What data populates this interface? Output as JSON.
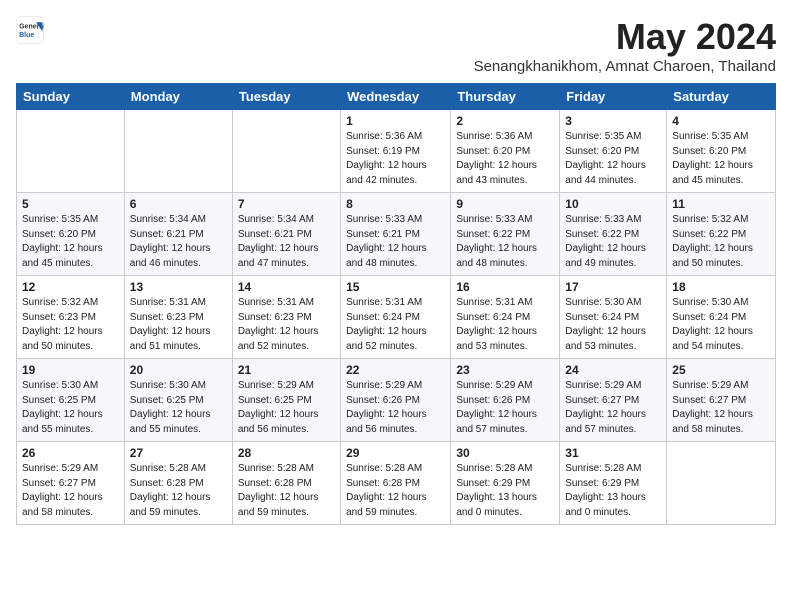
{
  "header": {
    "logo_general": "General",
    "logo_blue": "Blue",
    "month_title": "May 2024",
    "location": "Senangkhanikhom, Amnat Charoen, Thailand"
  },
  "weekdays": [
    "Sunday",
    "Monday",
    "Tuesday",
    "Wednesday",
    "Thursday",
    "Friday",
    "Saturday"
  ],
  "weeks": [
    [
      {
        "day": "",
        "info": ""
      },
      {
        "day": "",
        "info": ""
      },
      {
        "day": "",
        "info": ""
      },
      {
        "day": "1",
        "info": "Sunrise: 5:36 AM\nSunset: 6:19 PM\nDaylight: 12 hours\nand 42 minutes."
      },
      {
        "day": "2",
        "info": "Sunrise: 5:36 AM\nSunset: 6:20 PM\nDaylight: 12 hours\nand 43 minutes."
      },
      {
        "day": "3",
        "info": "Sunrise: 5:35 AM\nSunset: 6:20 PM\nDaylight: 12 hours\nand 44 minutes."
      },
      {
        "day": "4",
        "info": "Sunrise: 5:35 AM\nSunset: 6:20 PM\nDaylight: 12 hours\nand 45 minutes."
      }
    ],
    [
      {
        "day": "5",
        "info": "Sunrise: 5:35 AM\nSunset: 6:20 PM\nDaylight: 12 hours\nand 45 minutes."
      },
      {
        "day": "6",
        "info": "Sunrise: 5:34 AM\nSunset: 6:21 PM\nDaylight: 12 hours\nand 46 minutes."
      },
      {
        "day": "7",
        "info": "Sunrise: 5:34 AM\nSunset: 6:21 PM\nDaylight: 12 hours\nand 47 minutes."
      },
      {
        "day": "8",
        "info": "Sunrise: 5:33 AM\nSunset: 6:21 PM\nDaylight: 12 hours\nand 48 minutes."
      },
      {
        "day": "9",
        "info": "Sunrise: 5:33 AM\nSunset: 6:22 PM\nDaylight: 12 hours\nand 48 minutes."
      },
      {
        "day": "10",
        "info": "Sunrise: 5:33 AM\nSunset: 6:22 PM\nDaylight: 12 hours\nand 49 minutes."
      },
      {
        "day": "11",
        "info": "Sunrise: 5:32 AM\nSunset: 6:22 PM\nDaylight: 12 hours\nand 50 minutes."
      }
    ],
    [
      {
        "day": "12",
        "info": "Sunrise: 5:32 AM\nSunset: 6:23 PM\nDaylight: 12 hours\nand 50 minutes."
      },
      {
        "day": "13",
        "info": "Sunrise: 5:31 AM\nSunset: 6:23 PM\nDaylight: 12 hours\nand 51 minutes."
      },
      {
        "day": "14",
        "info": "Sunrise: 5:31 AM\nSunset: 6:23 PM\nDaylight: 12 hours\nand 52 minutes."
      },
      {
        "day": "15",
        "info": "Sunrise: 5:31 AM\nSunset: 6:24 PM\nDaylight: 12 hours\nand 52 minutes."
      },
      {
        "day": "16",
        "info": "Sunrise: 5:31 AM\nSunset: 6:24 PM\nDaylight: 12 hours\nand 53 minutes."
      },
      {
        "day": "17",
        "info": "Sunrise: 5:30 AM\nSunset: 6:24 PM\nDaylight: 12 hours\nand 53 minutes."
      },
      {
        "day": "18",
        "info": "Sunrise: 5:30 AM\nSunset: 6:24 PM\nDaylight: 12 hours\nand 54 minutes."
      }
    ],
    [
      {
        "day": "19",
        "info": "Sunrise: 5:30 AM\nSunset: 6:25 PM\nDaylight: 12 hours\nand 55 minutes."
      },
      {
        "day": "20",
        "info": "Sunrise: 5:30 AM\nSunset: 6:25 PM\nDaylight: 12 hours\nand 55 minutes."
      },
      {
        "day": "21",
        "info": "Sunrise: 5:29 AM\nSunset: 6:25 PM\nDaylight: 12 hours\nand 56 minutes."
      },
      {
        "day": "22",
        "info": "Sunrise: 5:29 AM\nSunset: 6:26 PM\nDaylight: 12 hours\nand 56 minutes."
      },
      {
        "day": "23",
        "info": "Sunrise: 5:29 AM\nSunset: 6:26 PM\nDaylight: 12 hours\nand 57 minutes."
      },
      {
        "day": "24",
        "info": "Sunrise: 5:29 AM\nSunset: 6:27 PM\nDaylight: 12 hours\nand 57 minutes."
      },
      {
        "day": "25",
        "info": "Sunrise: 5:29 AM\nSunset: 6:27 PM\nDaylight: 12 hours\nand 58 minutes."
      }
    ],
    [
      {
        "day": "26",
        "info": "Sunrise: 5:29 AM\nSunset: 6:27 PM\nDaylight: 12 hours\nand 58 minutes."
      },
      {
        "day": "27",
        "info": "Sunrise: 5:28 AM\nSunset: 6:28 PM\nDaylight: 12 hours\nand 59 minutes."
      },
      {
        "day": "28",
        "info": "Sunrise: 5:28 AM\nSunset: 6:28 PM\nDaylight: 12 hours\nand 59 minutes."
      },
      {
        "day": "29",
        "info": "Sunrise: 5:28 AM\nSunset: 6:28 PM\nDaylight: 12 hours\nand 59 minutes."
      },
      {
        "day": "30",
        "info": "Sunrise: 5:28 AM\nSunset: 6:29 PM\nDaylight: 13 hours\nand 0 minutes."
      },
      {
        "day": "31",
        "info": "Sunrise: 5:28 AM\nSunset: 6:29 PM\nDaylight: 13 hours\nand 0 minutes."
      },
      {
        "day": "",
        "info": ""
      }
    ]
  ]
}
